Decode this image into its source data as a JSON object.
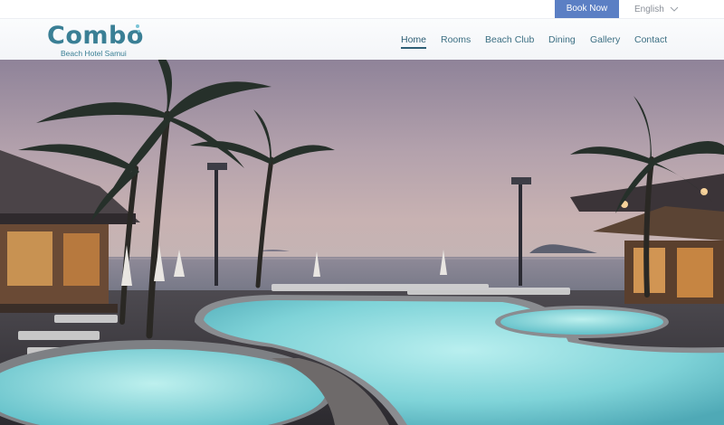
{
  "topbar": {
    "book_now": "Book Now",
    "language": "English"
  },
  "brand": {
    "name": "Combo",
    "tagline": "Beach Hotel Samui"
  },
  "nav": {
    "items": [
      {
        "label": "Home",
        "active": true
      },
      {
        "label": "Rooms"
      },
      {
        "label": "Beach Club"
      },
      {
        "label": "Dining"
      },
      {
        "label": "Gallery"
      },
      {
        "label": "Contact"
      }
    ]
  },
  "colors": {
    "accent": "#5b7fc4",
    "brand": "#3a7f95",
    "nav_text": "#3c6f83"
  },
  "hero": {
    "scene": "pool-at-dusk-photo"
  }
}
